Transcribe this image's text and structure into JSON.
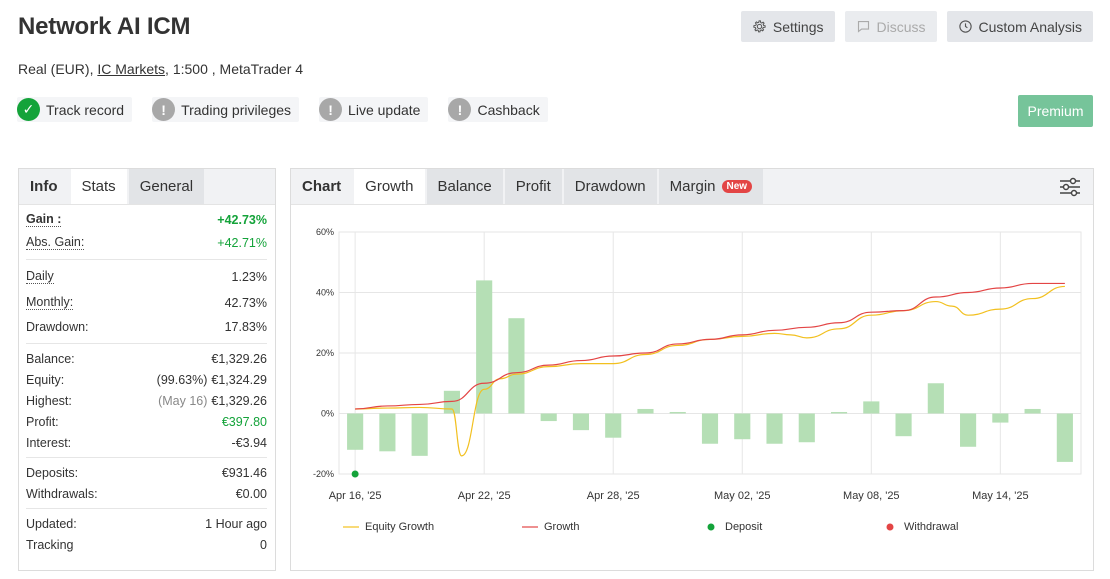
{
  "header": {
    "title": "Network AI ICM",
    "account_type": "Real (EUR),",
    "broker": "IC Markets",
    "leverage_platform": ", 1:500 , MetaTrader 4"
  },
  "buttons": {
    "settings": "Settings",
    "discuss": "Discuss",
    "custom_analysis": "Custom Analysis",
    "premium": "Premium"
  },
  "badges": [
    {
      "label": "Track record",
      "status": "ok"
    },
    {
      "label": "Trading privileges",
      "status": "warn"
    },
    {
      "label": "Live update",
      "status": "warn"
    },
    {
      "label": "Cashback",
      "status": "warn"
    }
  ],
  "left_tabs": [
    "Info",
    "Stats",
    "General"
  ],
  "stats": {
    "gain": {
      "label": "Gain :",
      "value": "+42.73%"
    },
    "abs_gain": {
      "label": "Abs. Gain:",
      "value": "+42.71%"
    },
    "daily": {
      "label": "Daily",
      "value": "1.23%"
    },
    "monthly": {
      "label": "Monthly:",
      "value": "42.73%"
    },
    "drawdown": {
      "label": "Drawdown:",
      "value": "17.83%"
    },
    "balance": {
      "label": "Balance:",
      "value": "€1,329.26"
    },
    "equity": {
      "label": "Equity:",
      "note": "(99.63%)",
      "value": "€1,324.29"
    },
    "highest": {
      "label": "Highest:",
      "note": "(May 16)",
      "value": "€1,329.26"
    },
    "profit": {
      "label": "Profit:",
      "value": "€397.80"
    },
    "interest": {
      "label": "Interest:",
      "value": "-€3.94"
    },
    "deposits": {
      "label": "Deposits:",
      "value": "€931.46"
    },
    "withdrawals": {
      "label": "Withdrawals:",
      "value": "€0.00"
    },
    "updated": {
      "label": "Updated:",
      "value": "1 Hour ago"
    },
    "tracking": {
      "label": "Tracking",
      "value": "0"
    }
  },
  "chart_tabs": {
    "head": "Chart",
    "items": [
      "Growth",
      "Balance",
      "Profit",
      "Drawdown",
      "Margin"
    ],
    "new_badge": "New"
  },
  "colors": {
    "green_text": "#14a33a",
    "bar": "#b5dfb5",
    "equity_line": "#f2c01f",
    "growth_line": "#e34545",
    "deposit": "#14a33a",
    "withdrawal": "#e34545"
  },
  "chart_data": {
    "type": "bar",
    "ylim": [
      -20,
      60
    ],
    "yticks": [
      -20,
      0,
      20,
      40,
      60
    ],
    "ytick_labels": [
      "-20%",
      "0%",
      "20%",
      "40%",
      "60%"
    ],
    "xtick_labels": [
      {
        "index": 0,
        "label": "Apr 16, '25"
      },
      {
        "index": 4,
        "label": "Apr 22, '25"
      },
      {
        "index": 8,
        "label": "Apr 28, '25"
      },
      {
        "index": 12,
        "label": "May 02, '25"
      },
      {
        "index": 16,
        "label": "May 08, '25"
      },
      {
        "index": 20,
        "label": "May 14, '25"
      }
    ],
    "bars": [
      -12,
      -12.5,
      -14,
      7.5,
      44,
      31.5,
      -2.5,
      -5.5,
      -8,
      1.5,
      0.5,
      -10,
      -8.5,
      -10,
      -9.5,
      0.5,
      4,
      -7.5,
      10,
      -11,
      -3,
      1.5,
      -16
    ],
    "legend": [
      "Equity Growth",
      "Growth",
      "Deposit",
      "Withdrawal"
    ],
    "series": [
      {
        "name": "Growth",
        "x": [
          0,
          1,
          2,
          3,
          4,
          5,
          6,
          7,
          8,
          9,
          10,
          11,
          12,
          13,
          14,
          15,
          16,
          17,
          18,
          19,
          20,
          21,
          22
        ],
        "values": [
          1.5,
          2.5,
          3,
          4,
          10,
          13.5,
          16,
          17.5,
          19,
          20,
          23,
          24.5,
          26,
          27.5,
          28.5,
          30,
          33.5,
          34,
          38.5,
          40,
          41.5,
          43,
          43
        ]
      },
      {
        "name": "Equity Growth",
        "x": [
          0,
          1,
          2,
          3,
          3.3,
          4,
          4.5,
          5,
          6,
          7,
          8,
          9,
          10,
          11,
          12,
          13,
          13.5,
          14,
          15,
          16,
          17,
          18,
          18.5,
          19,
          20,
          21,
          22
        ],
        "values": [
          1.5,
          1.8,
          2,
          1.5,
          -14,
          8,
          11.5,
          13,
          15.5,
          16.5,
          16.5,
          19.5,
          22.5,
          24.5,
          25.5,
          26.5,
          26,
          25,
          28,
          32.5,
          34,
          37,
          35.5,
          32.5,
          34.5,
          38,
          42
        ]
      }
    ],
    "deposit_points": [
      {
        "index": 0,
        "value": -20
      }
    ],
    "grid": true
  }
}
